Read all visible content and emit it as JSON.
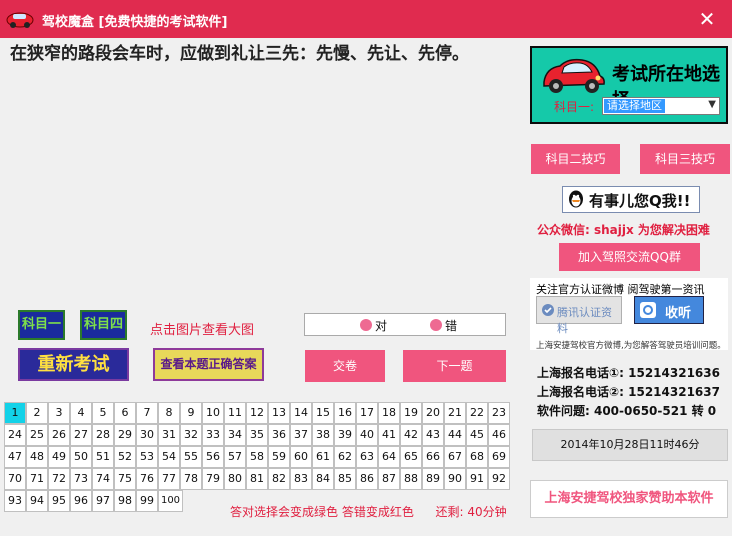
{
  "window": {
    "title": "驾校魔盒 [免费快捷的考试软件]",
    "close_label": "✕"
  },
  "question": {
    "text": "在狭窄的路段会车时，应做到礼让三先：先慢、先让、先停。"
  },
  "location": {
    "title": "考试所在地选择",
    "subject_label": "科目一:",
    "select_value": "请选择地区"
  },
  "tips": {
    "subject2_label": "科目二技巧",
    "subject3_label": "科目三技巧"
  },
  "qq": {
    "label": "有事儿您Q我!!"
  },
  "wechat": {
    "text": "公众微信: shajjx 为您解决困难"
  },
  "join_group": {
    "label": "加入驾照交流QQ群"
  },
  "follow": {
    "title": "关注官方认证微博 阅驾驶第一资讯",
    "weibo_label": "腾讯认证资料",
    "shoucang_label": "收听",
    "note": "上海安捷驾校官方微博,为您解答驾驶员培训问题。"
  },
  "contacts": {
    "phone1": "上海报名电话①: 15214321636",
    "phone2": "上海报名电话②: 15214321637",
    "software": "软件问题: 400-0650-521 转 0"
  },
  "datetime": "2014年10月28日11时46分",
  "sponsor": "上海安捷驾校独家赞助本软件",
  "subjects": {
    "s1": "科目一",
    "s4": "科目四"
  },
  "restart_label": "重新考试",
  "image_hint": "点击图片查看大图",
  "view_answer_label": "查看本题正确答案",
  "answers": {
    "correct": "对",
    "wrong": "错"
  },
  "submit_label": "交卷",
  "next_label": "下一题",
  "current_question": 1,
  "question_numbers": [
    "1",
    "2",
    "3",
    "4",
    "5",
    "6",
    "7",
    "8",
    "9",
    "10",
    "11",
    "12",
    "13",
    "14",
    "15",
    "16",
    "17",
    "18",
    "19",
    "20",
    "21",
    "22",
    "23",
    "24",
    "25",
    "26",
    "27",
    "28",
    "29",
    "30",
    "31",
    "32",
    "33",
    "34",
    "35",
    "36",
    "37",
    "38",
    "39",
    "40",
    "41",
    "42",
    "43",
    "44",
    "45",
    "46",
    "47",
    "48",
    "49",
    "50",
    "51",
    "52",
    "53",
    "54",
    "55",
    "56",
    "57",
    "58",
    "59",
    "60",
    "61",
    "62",
    "63",
    "64",
    "65",
    "66",
    "67",
    "68",
    "69",
    "70",
    "71",
    "72",
    "73",
    "74",
    "75",
    "76",
    "77",
    "78",
    "79",
    "80",
    "81",
    "82",
    "83",
    "84",
    "85",
    "86",
    "87",
    "88",
    "89",
    "90",
    "91",
    "92",
    "93",
    "94",
    "95",
    "96",
    "97",
    "98",
    "99",
    "100"
  ],
  "status": {
    "legend": "答对选择会变成绿色 答错变成红色",
    "remaining": "还剩: 40分钟"
  },
  "colors": {
    "title_bar": "#e02b4f",
    "accent_pink": "#f0557e",
    "loc_bg": "#15c9a9",
    "current_cell": "#13d2e8"
  }
}
